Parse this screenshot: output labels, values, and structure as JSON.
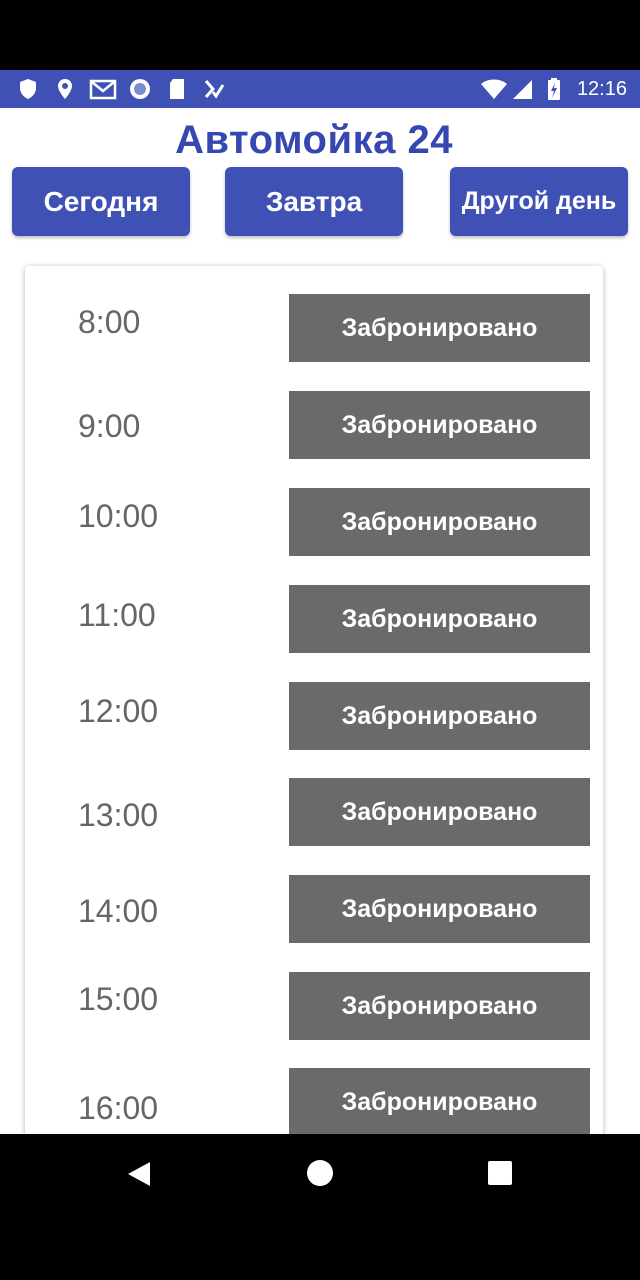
{
  "status_bar": {
    "time": "12:16",
    "left_icons": [
      "shield-icon",
      "location-pin-icon",
      "gmail-icon",
      "circle-app-icon",
      "sd-card-icon",
      "task-check-icon"
    ],
    "right_icons": [
      "wifi-icon",
      "signal-icon",
      "battery-charging-icon"
    ],
    "background": "#3f51b5"
  },
  "app": {
    "title": "Автомойка 24",
    "title_color": "#3547b0",
    "accent": "#3f51b5"
  },
  "day_buttons": [
    {
      "label": "Сегодня"
    },
    {
      "label": "Завтра"
    },
    {
      "label": "Другой день"
    }
  ],
  "slots": [
    {
      "time": "8:00",
      "status": "Забронировано"
    },
    {
      "time": "9:00",
      "status": "Забронировано"
    },
    {
      "time": "10:00",
      "status": "Забронировано"
    },
    {
      "time": "11:00",
      "status": "Забронировано"
    },
    {
      "time": "12:00",
      "status": "Забронировано"
    },
    {
      "time": "13:00",
      "status": "Забронировано"
    },
    {
      "time": "14:00",
      "status": "Забронировано"
    },
    {
      "time": "15:00",
      "status": "Забронировано"
    },
    {
      "time": "16:00",
      "status": "Забронировано"
    }
  ],
  "slot_button_color": "#6b6969",
  "nav_bar": {
    "icons": [
      "back-icon",
      "home-icon",
      "recent-apps-icon"
    ]
  }
}
